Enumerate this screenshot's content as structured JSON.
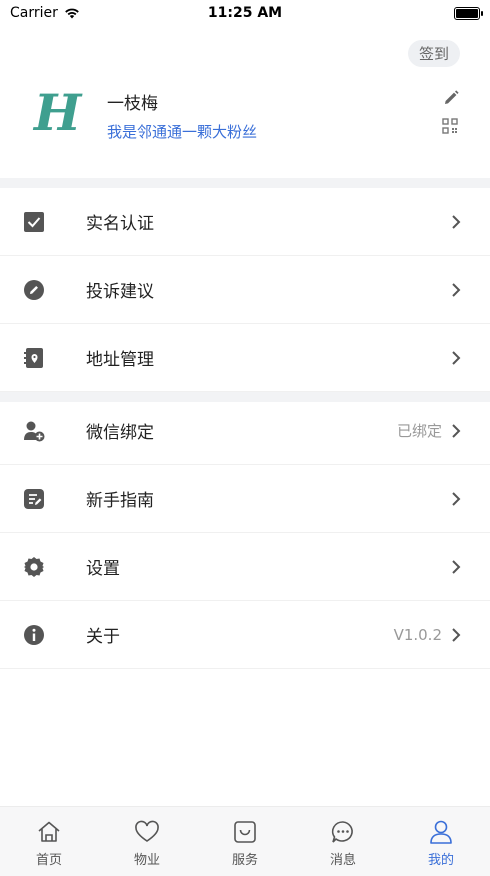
{
  "status_bar": {
    "carrier": "Carrier",
    "time": "11:25 AM"
  },
  "profile": {
    "signin_label": "签到",
    "logo_letter": "H",
    "name": "一枝梅",
    "bio": "我是邻通通一颗大粉丝",
    "accent_color": "#3a6fd8",
    "logo_color": "#3f9f8f"
  },
  "menu_group_1": [
    {
      "label": "实名认证",
      "icon": "checkbox-icon"
    },
    {
      "label": "投诉建议",
      "icon": "pencil-circle-icon"
    },
    {
      "label": "地址管理",
      "icon": "address-book-icon"
    }
  ],
  "menu_group_2": [
    {
      "label": "微信绑定",
      "icon": "user-add-icon",
      "value": "已绑定"
    },
    {
      "label": "新手指南",
      "icon": "document-icon"
    },
    {
      "label": "设置",
      "icon": "gear-icon"
    },
    {
      "label": "关于",
      "icon": "info-icon",
      "value": "V1.0.2"
    }
  ],
  "tab_bar": [
    {
      "label": "首页",
      "icon": "home-icon",
      "active": false
    },
    {
      "label": "物业",
      "icon": "heart-icon",
      "active": false
    },
    {
      "label": "服务",
      "icon": "service-icon",
      "active": false
    },
    {
      "label": "消息",
      "icon": "chat-icon",
      "active": false
    },
    {
      "label": "我的",
      "icon": "person-icon",
      "active": true
    }
  ]
}
